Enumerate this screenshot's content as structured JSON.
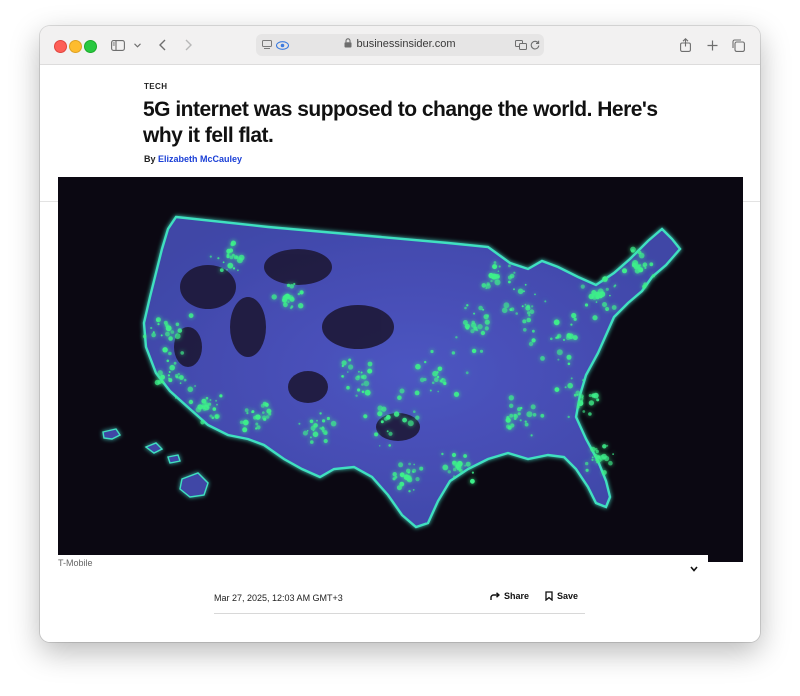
{
  "browser": {
    "url_display": "businessinsider.com"
  },
  "article": {
    "section": "TECH",
    "title": "5G internet was supposed to change the world. Here's why it fell flat.",
    "byline_prefix": "By",
    "author": "Elizabeth McCauley",
    "image_credit": "T-Mobile",
    "timestamp": "Mar 27, 2025, 12:03 AM GMT+3",
    "share_label": "Share",
    "save_label": "Save"
  },
  "colors": {
    "map_land": "#4a52b8",
    "map_coverage": "#3df08a",
    "map_background": "#0b0812",
    "author_link": "#1a3fd6"
  }
}
